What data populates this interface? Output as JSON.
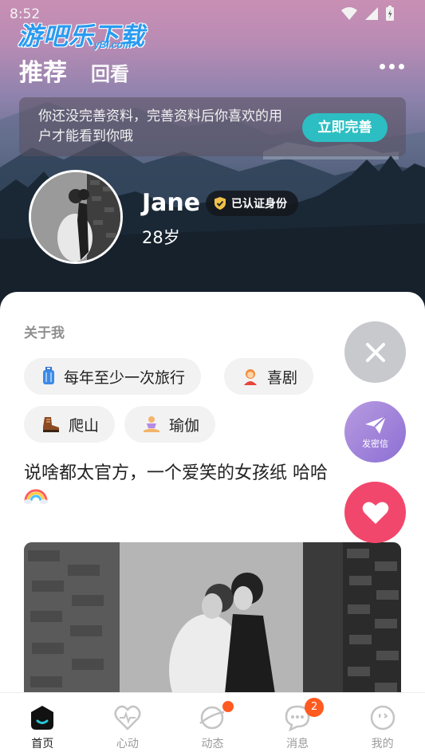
{
  "status_bar": {
    "time": "8:52",
    "icons": [
      "wifi-icon",
      "signal-icon",
      "battery-icon"
    ]
  },
  "watermark": {
    "main": "游吧乐下载",
    "sub": "yBl.com"
  },
  "header": {
    "tabs": [
      {
        "label": "推荐",
        "active": true
      },
      {
        "label": "回看",
        "active": false
      }
    ],
    "more_icon": "more-icon"
  },
  "banner": {
    "text": "你还没完善资料，完善资料后你喜欢的用户才能看到你哦",
    "button": "立即完善",
    "button_color": "#2cbec2"
  },
  "profile": {
    "name": "Jane",
    "badge": "已认证身份",
    "age": "28岁"
  },
  "about": {
    "title": "关于我",
    "tags": [
      {
        "label": "每年至少一次旅行",
        "icon": "luggage-icon"
      },
      {
        "label": "喜剧",
        "icon": "person-icon"
      },
      {
        "label": "爬山",
        "icon": "hiking-boot-icon"
      },
      {
        "label": "瑜伽",
        "icon": "yoga-icon"
      }
    ],
    "bio": "说啥都太官方，一个爱笑的女孩纸 哈哈",
    "bio_emoji": "rainbow-icon"
  },
  "actions": {
    "close_icon": "close-icon",
    "message_label": "发密信",
    "message_icon": "paper-plane-icon",
    "like_icon": "heart-icon",
    "like_color": "#f2476c"
  },
  "bottom_nav": [
    {
      "label": "首页",
      "icon": "home-icon",
      "active": true
    },
    {
      "label": "心动",
      "icon": "heartbeat-icon",
      "active": false
    },
    {
      "label": "动态",
      "icon": "planet-icon",
      "active": false,
      "dot": true
    },
    {
      "label": "消息",
      "icon": "chat-icon",
      "active": false,
      "badge": "2"
    },
    {
      "label": "我的",
      "icon": "profile-face-icon",
      "active": false
    }
  ]
}
